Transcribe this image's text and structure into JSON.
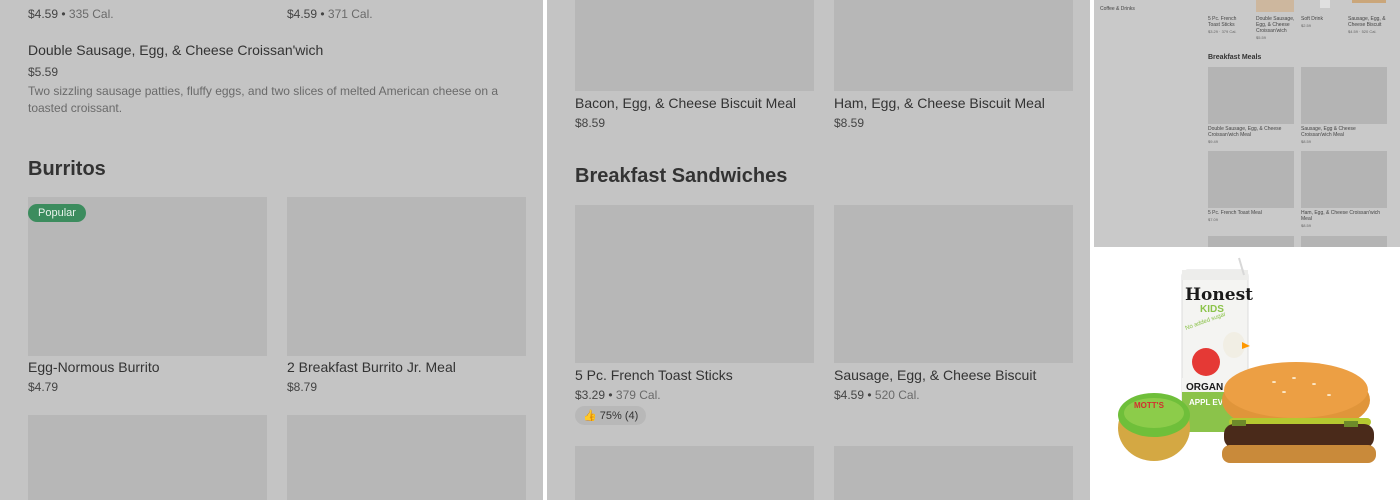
{
  "panel_left": {
    "top_items": [
      {
        "price": "$4.59",
        "cal": "335 Cal."
      },
      {
        "price": "$4.59",
        "cal": "371 Cal."
      }
    ],
    "featured_item": {
      "title": "Double Sausage, Egg, & Cheese Croissan'wich",
      "price": "$5.59",
      "description": "Two sizzling sausage patties, fluffy eggs, and two slices of melted American cheese on a toasted croissant."
    },
    "section_title": "Burritos",
    "badge": "Popular",
    "items": [
      {
        "title": "Egg-Normous Burrito",
        "price": "$4.79"
      },
      {
        "title": "2 Breakfast Burrito Jr. Meal",
        "price": "$8.79"
      }
    ]
  },
  "panel_middle": {
    "top_items": [
      {
        "title": "Bacon, Egg, & Cheese Biscuit Meal",
        "price": "$8.59"
      },
      {
        "title": "Ham, Egg, & Cheese Biscuit Meal",
        "price": "$8.59"
      }
    ],
    "section_title": "Breakfast Sandwiches",
    "items": [
      {
        "title": "5 Pc. French Toast Sticks",
        "price": "$3.29",
        "cal": "379 Cal.",
        "rating": "75% (4)"
      },
      {
        "title": "Sausage, Egg, & Cheese Biscuit",
        "price": "$4.59",
        "cal": "520 Cal."
      }
    ]
  },
  "panel_mini": {
    "sidebar_label": "Coffee & Drinks",
    "top_items": [
      {
        "title": "5 Pc. French Toast Sticks",
        "price": "$3.29 · 379 Cal."
      },
      {
        "title": "Double Sausage, Egg, & Cheese Croissan'wich",
        "price": "$5.59"
      },
      {
        "title": "Soft Drink",
        "price": "$2.59"
      },
      {
        "title": "Sausage, Egg, & Cheese Biscuit",
        "price": "$4.59 · 520 Cal."
      }
    ],
    "section_title": "Breakfast Meals",
    "meals": [
      {
        "title": "Double Sausage, Egg, & Cheese Croissan'wich Meal",
        "price": "$9.49"
      },
      {
        "title": "Sausage, Egg & Cheese Croissan'wich Meal",
        "price": "$8.59"
      },
      {
        "title": "5 Pc. French Toast Meal",
        "price": "$7.09"
      },
      {
        "title": "Ham, Egg, & Cheese Croissan'wich Meal",
        "price": "$8.59"
      }
    ]
  },
  "product_image": {
    "juice_brand": "Honest",
    "juice_sub": "KIDS",
    "juice_tag": "No added sugar",
    "juice_organic": "ORGAN",
    "juice_flavor": "APPL EVER",
    "applesauce_brand": "MOTT'S"
  }
}
